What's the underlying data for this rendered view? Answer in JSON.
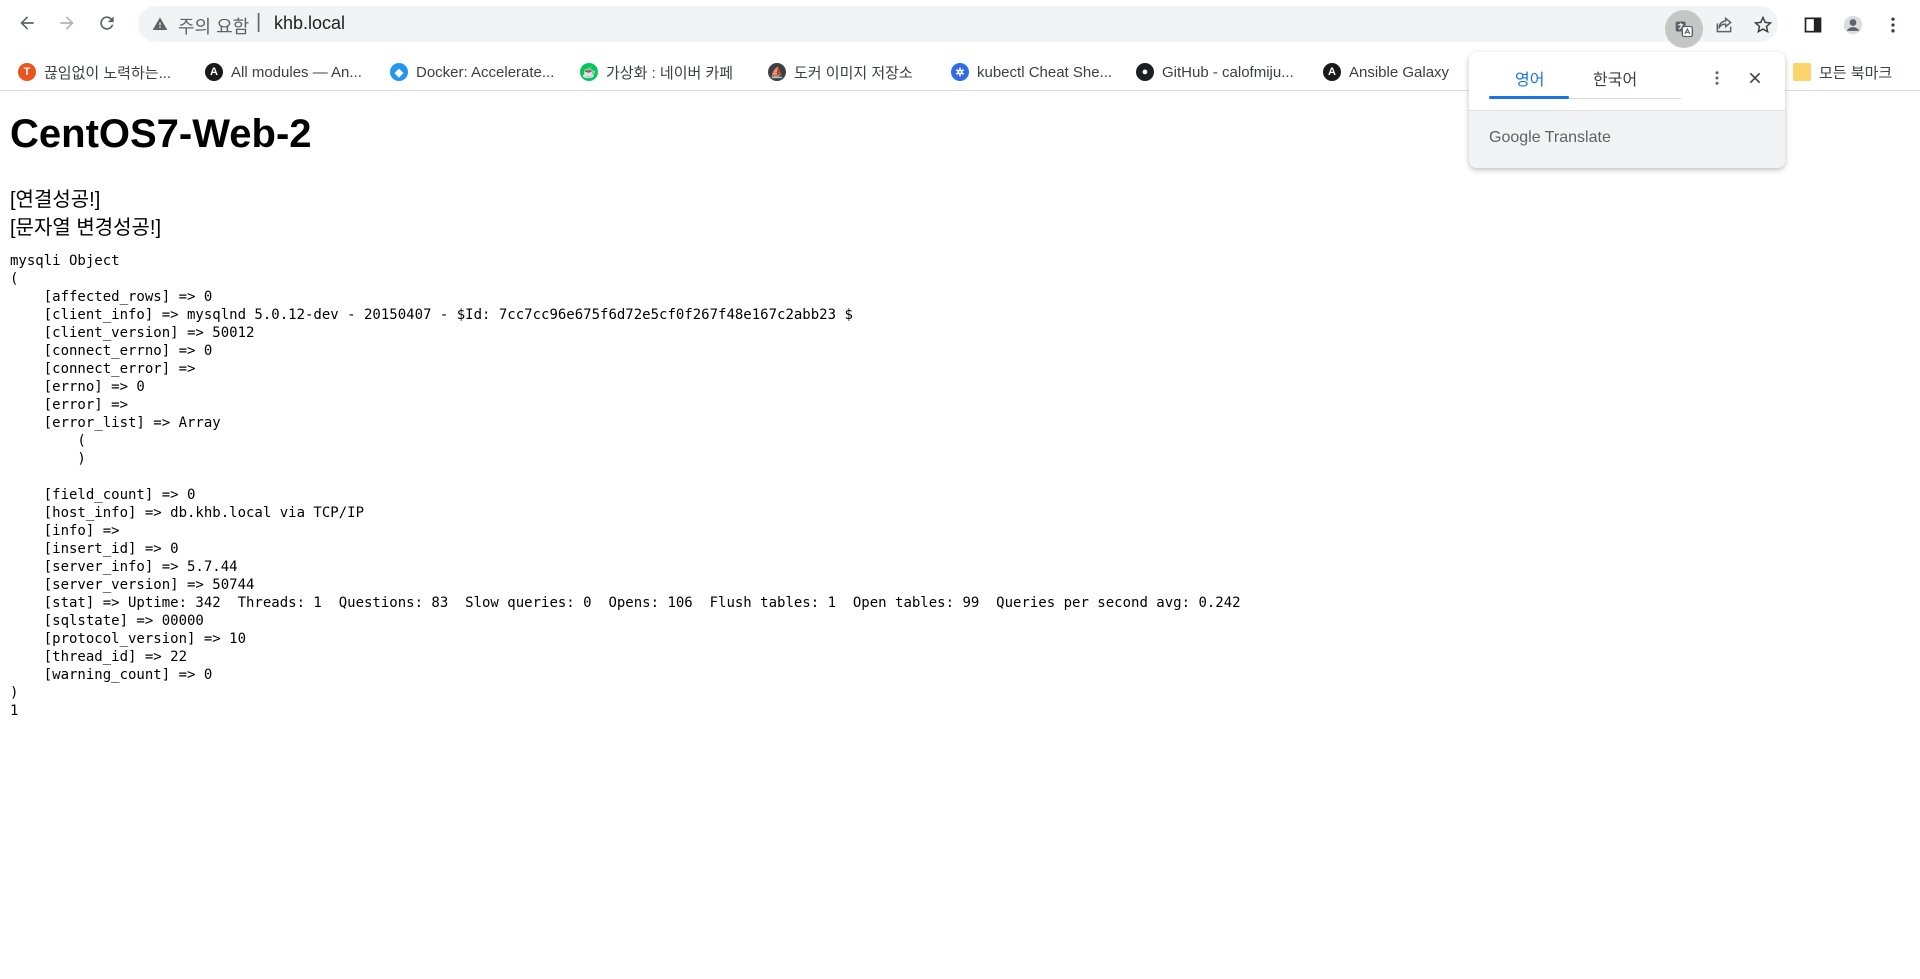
{
  "browser": {
    "security_label": "주의 요함",
    "separator": "|",
    "url": "khb.local"
  },
  "bookmarks": [
    {
      "label": "끊임없이 노력하는...",
      "icon": "tistory-icon",
      "color": "#eb531f"
    },
    {
      "label": "All modules — An...",
      "icon": "ansible-icon",
      "color": "#1a1918"
    },
    {
      "label": "Docker: Accelerate...",
      "icon": "docker-icon",
      "color": "#2496ed"
    },
    {
      "label": "가상화 : 네이버 카페",
      "icon": "naver-cafe-icon",
      "color": "#03c75a"
    },
    {
      "label": "도커 이미지 저장소",
      "icon": "harbor-icon",
      "color": "#3c4043"
    },
    {
      "label": "kubectl Cheat She...",
      "icon": "kubernetes-icon",
      "color": "#326ce5"
    },
    {
      "label": "GitHub - calofmiju...",
      "icon": "github-icon",
      "color": "#1b1f23"
    },
    {
      "label": "Ansible Galaxy",
      "icon": "ansible-icon",
      "color": "#1a1918"
    },
    {
      "label": "모든 북마크",
      "icon": "folder-icon",
      "color": "#fbd56b"
    }
  ],
  "page": {
    "title": "CentOS7-Web-2",
    "line1": "[연결성공!]",
    "line2": "[문자열 변경성공!]",
    "dump": "mysqli Object\n(\n    [affected_rows] => 0\n    [client_info] => mysqlnd 5.0.12-dev - 20150407 - $Id: 7cc7cc96e675f6d72e5cf0f267f48e167c2abb23 $\n    [client_version] => 50012\n    [connect_errno] => 0\n    [connect_error] => \n    [errno] => 0\n    [error] => \n    [error_list] => Array\n        (\n        )\n\n    [field_count] => 0\n    [host_info] => db.khb.local via TCP/IP\n    [info] => \n    [insert_id] => 0\n    [server_info] => 5.7.44\n    [server_version] => 50744\n    [stat] => Uptime: 342  Threads: 1  Questions: 83  Slow queries: 0  Opens: 106  Flush tables: 1  Open tables: 99  Queries per second avg: 0.242\n    [sqlstate] => 00000\n    [protocol_version] => 10\n    [thread_id] => 22\n    [warning_count] => 0\n)\n1"
  },
  "translate_popup": {
    "tab_source": "영어",
    "tab_target": "한국어",
    "brand_google": "Google",
    "brand_translate": "Translate"
  },
  "colors": {
    "accent": "#1a73e8",
    "omnibox_bg": "#f1f3f4"
  }
}
